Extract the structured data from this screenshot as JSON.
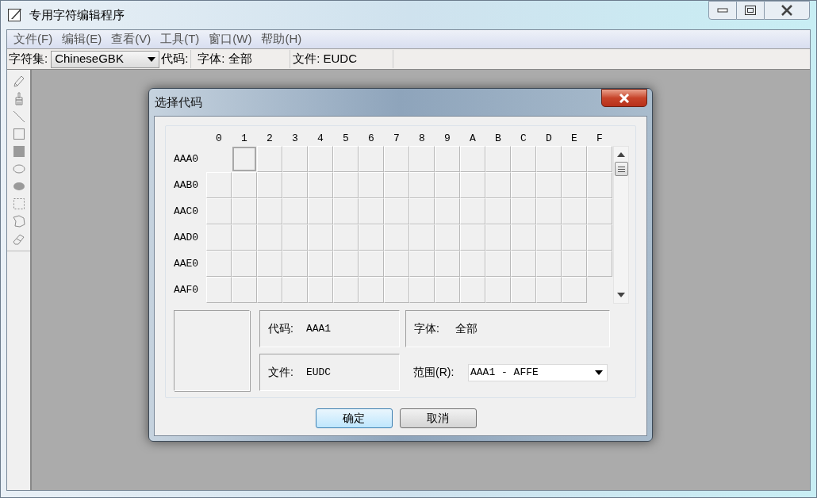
{
  "window": {
    "title": "专用字符编辑程序"
  },
  "menu": [
    "文件(F)",
    "编辑(E)",
    "查看(V)",
    "工具(T)",
    "窗口(W)",
    "帮助(H)"
  ],
  "toolbar": {
    "charset_label": "字符集:",
    "charset_value": "ChineseGBK",
    "code_label": "代码:",
    "font_label": "字体: 全部",
    "file_label": "文件: EUDC"
  },
  "tools": [
    {
      "kind": "pencil"
    },
    {
      "kind": "brush"
    },
    {
      "kind": "line"
    },
    {
      "kind": "rect"
    },
    {
      "kind": "filled_rect"
    },
    {
      "kind": "ellipse"
    },
    {
      "kind": "filled_ellipse"
    },
    {
      "kind": "rect_select"
    },
    {
      "kind": "free_select"
    },
    {
      "kind": "eraser"
    }
  ],
  "dialog": {
    "title": "选择代码",
    "columns": [
      "0",
      "1",
      "2",
      "3",
      "4",
      "5",
      "6",
      "7",
      "8",
      "9",
      "A",
      "B",
      "C",
      "D",
      "E",
      "F"
    ],
    "rows": [
      {
        "label": "AAA0",
        "cells": [
          {
            "kind": "empty"
          },
          {
            "kind": "cell",
            "selected": true
          },
          {
            "kind": "cell",
            "selected": false
          },
          {
            "kind": "cell",
            "selected": false
          },
          {
            "kind": "cell",
            "selected": false
          },
          {
            "kind": "cell",
            "selected": false
          },
          {
            "kind": "cell",
            "selected": false
          },
          {
            "kind": "cell",
            "selected": false
          },
          {
            "kind": "cell",
            "selected": false
          },
          {
            "kind": "cell",
            "selected": false
          },
          {
            "kind": "cell",
            "selected": false
          },
          {
            "kind": "cell",
            "selected": false
          },
          {
            "kind": "cell",
            "selected": false
          },
          {
            "kind": "cell",
            "selected": false
          },
          {
            "kind": "cell",
            "selected": false
          },
          {
            "kind": "cell",
            "selected": false
          }
        ]
      },
      {
        "label": "AAB0",
        "cells": [
          {
            "kind": "cell",
            "selected": false
          },
          {
            "kind": "cell",
            "selected": false
          },
          {
            "kind": "cell",
            "selected": false
          },
          {
            "kind": "cell",
            "selected": false
          },
          {
            "kind": "cell",
            "selected": false
          },
          {
            "kind": "cell",
            "selected": false
          },
          {
            "kind": "cell",
            "selected": false
          },
          {
            "kind": "cell",
            "selected": false
          },
          {
            "kind": "cell",
            "selected": false
          },
          {
            "kind": "cell",
            "selected": false
          },
          {
            "kind": "cell",
            "selected": false
          },
          {
            "kind": "cell",
            "selected": false
          },
          {
            "kind": "cell",
            "selected": false
          },
          {
            "kind": "cell",
            "selected": false
          },
          {
            "kind": "cell",
            "selected": false
          },
          {
            "kind": "cell",
            "selected": false
          }
        ]
      },
      {
        "label": "AAC0",
        "cells": [
          {
            "kind": "cell",
            "selected": false
          },
          {
            "kind": "cell",
            "selected": false
          },
          {
            "kind": "cell",
            "selected": false
          },
          {
            "kind": "cell",
            "selected": false
          },
          {
            "kind": "cell",
            "selected": false
          },
          {
            "kind": "cell",
            "selected": false
          },
          {
            "kind": "cell",
            "selected": false
          },
          {
            "kind": "cell",
            "selected": false
          },
          {
            "kind": "cell",
            "selected": false
          },
          {
            "kind": "cell",
            "selected": false
          },
          {
            "kind": "cell",
            "selected": false
          },
          {
            "kind": "cell",
            "selected": false
          },
          {
            "kind": "cell",
            "selected": false
          },
          {
            "kind": "cell",
            "selected": false
          },
          {
            "kind": "cell",
            "selected": false
          },
          {
            "kind": "cell",
            "selected": false
          }
        ]
      },
      {
        "label": "AAD0",
        "cells": [
          {
            "kind": "cell",
            "selected": false
          },
          {
            "kind": "cell",
            "selected": false
          },
          {
            "kind": "cell",
            "selected": false
          },
          {
            "kind": "cell",
            "selected": false
          },
          {
            "kind": "cell",
            "selected": false
          },
          {
            "kind": "cell",
            "selected": false
          },
          {
            "kind": "cell",
            "selected": false
          },
          {
            "kind": "cell",
            "selected": false
          },
          {
            "kind": "cell",
            "selected": false
          },
          {
            "kind": "cell",
            "selected": false
          },
          {
            "kind": "cell",
            "selected": false
          },
          {
            "kind": "cell",
            "selected": false
          },
          {
            "kind": "cell",
            "selected": false
          },
          {
            "kind": "cell",
            "selected": false
          },
          {
            "kind": "cell",
            "selected": false
          },
          {
            "kind": "cell",
            "selected": false
          }
        ]
      },
      {
        "label": "AAE0",
        "cells": [
          {
            "kind": "cell",
            "selected": false
          },
          {
            "kind": "cell",
            "selected": false
          },
          {
            "kind": "cell",
            "selected": false
          },
          {
            "kind": "cell",
            "selected": false
          },
          {
            "kind": "cell",
            "selected": false
          },
          {
            "kind": "cell",
            "selected": false
          },
          {
            "kind": "cell",
            "selected": false
          },
          {
            "kind": "cell",
            "selected": false
          },
          {
            "kind": "cell",
            "selected": false
          },
          {
            "kind": "cell",
            "selected": false
          },
          {
            "kind": "cell",
            "selected": false
          },
          {
            "kind": "cell",
            "selected": false
          },
          {
            "kind": "cell",
            "selected": false
          },
          {
            "kind": "cell",
            "selected": false
          },
          {
            "kind": "cell",
            "selected": false
          },
          {
            "kind": "cell",
            "selected": false
          }
        ]
      },
      {
        "label": "AAF0",
        "cells": [
          {
            "kind": "cell",
            "selected": false
          },
          {
            "kind": "cell",
            "selected": false
          },
          {
            "kind": "cell",
            "selected": false
          },
          {
            "kind": "cell",
            "selected": false
          },
          {
            "kind": "cell",
            "selected": false
          },
          {
            "kind": "cell",
            "selected": false
          },
          {
            "kind": "cell",
            "selected": false
          },
          {
            "kind": "cell",
            "selected": false
          },
          {
            "kind": "cell",
            "selected": false
          },
          {
            "kind": "cell",
            "selected": false
          },
          {
            "kind": "cell",
            "selected": false
          },
          {
            "kind": "cell",
            "selected": false
          },
          {
            "kind": "cell",
            "selected": false
          },
          {
            "kind": "cell",
            "selected": false
          },
          {
            "kind": "cell",
            "selected": false
          },
          {
            "kind": "empty"
          }
        ]
      }
    ],
    "code_label": "代码:",
    "code_value": "AAA1",
    "font_label": "字体:",
    "font_value": "全部",
    "file_label": "文件:",
    "file_value": "EUDC",
    "range_label": "范围(R):",
    "range_value": "AAA1 - AFFE",
    "buttons": [
      {
        "label": "确定",
        "default": true
      },
      {
        "label": "取消",
        "default": false
      }
    ]
  }
}
